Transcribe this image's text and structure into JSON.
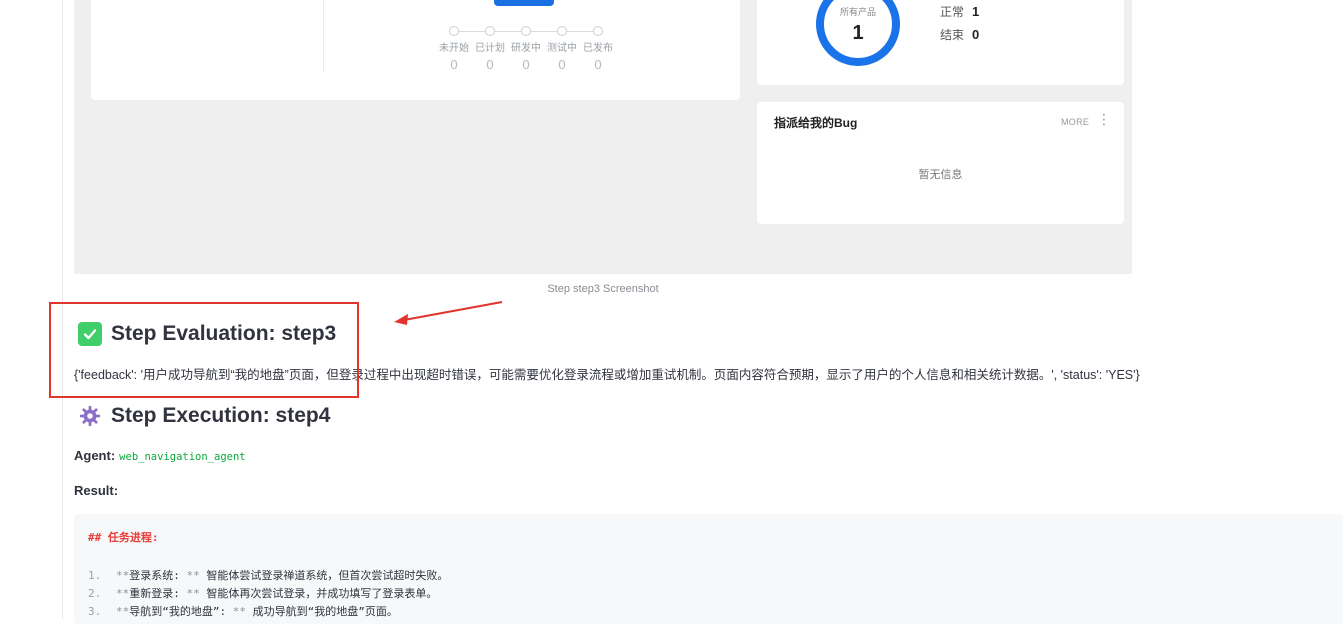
{
  "screenshot": {
    "pipeline": [
      {
        "label": "未开始",
        "count": "0"
      },
      {
        "label": "已计划",
        "count": "0"
      },
      {
        "label": "研发中",
        "count": "0"
      },
      {
        "label": "测试中",
        "count": "0"
      },
      {
        "label": "已发布",
        "count": "0"
      }
    ],
    "products": {
      "ring_label": "所有产品",
      "ring_value": "1",
      "stats": [
        {
          "label": "正常",
          "value": "1"
        },
        {
          "label": "结束",
          "value": "0"
        }
      ]
    },
    "bug_card": {
      "title": "指派给我的Bug",
      "more": "MORE",
      "empty": "暂无信息"
    },
    "colors": {
      "accent": "#1a73e8"
    }
  },
  "caption": "Step step3 Screenshot",
  "evaluation": {
    "title": "Step Evaluation: step3",
    "feedback": "{'feedback': '用户成功导航到“我的地盘”页面，但登录过程中出现超时错误，可能需要优化登录流程或增加重试机制。页面内容符合预期，显示了用户的个人信息和相关统计数据。', 'status': 'YES'}"
  },
  "execution": {
    "title": "Step Execution: step4",
    "agent_label": "Agent:",
    "agent_value": "web_navigation_agent",
    "result_label": "Result:",
    "code": {
      "heading": "## 任务进程:",
      "lines": [
        {
          "num": "1.",
          "head": "登录系统:",
          "text": "智能体尝试登录禅道系统，但首次尝试超时失败。"
        },
        {
          "num": "2.",
          "head": "重新登录:",
          "text": "智能体再次尝试登录，并成功填写了登录表单。"
        },
        {
          "num": "3.",
          "head": "导航到“我的地盘”:",
          "text": "成功导航到“我的地盘”页面。"
        }
      ]
    }
  },
  "annotation_colors": {
    "box": "#e0342c"
  }
}
